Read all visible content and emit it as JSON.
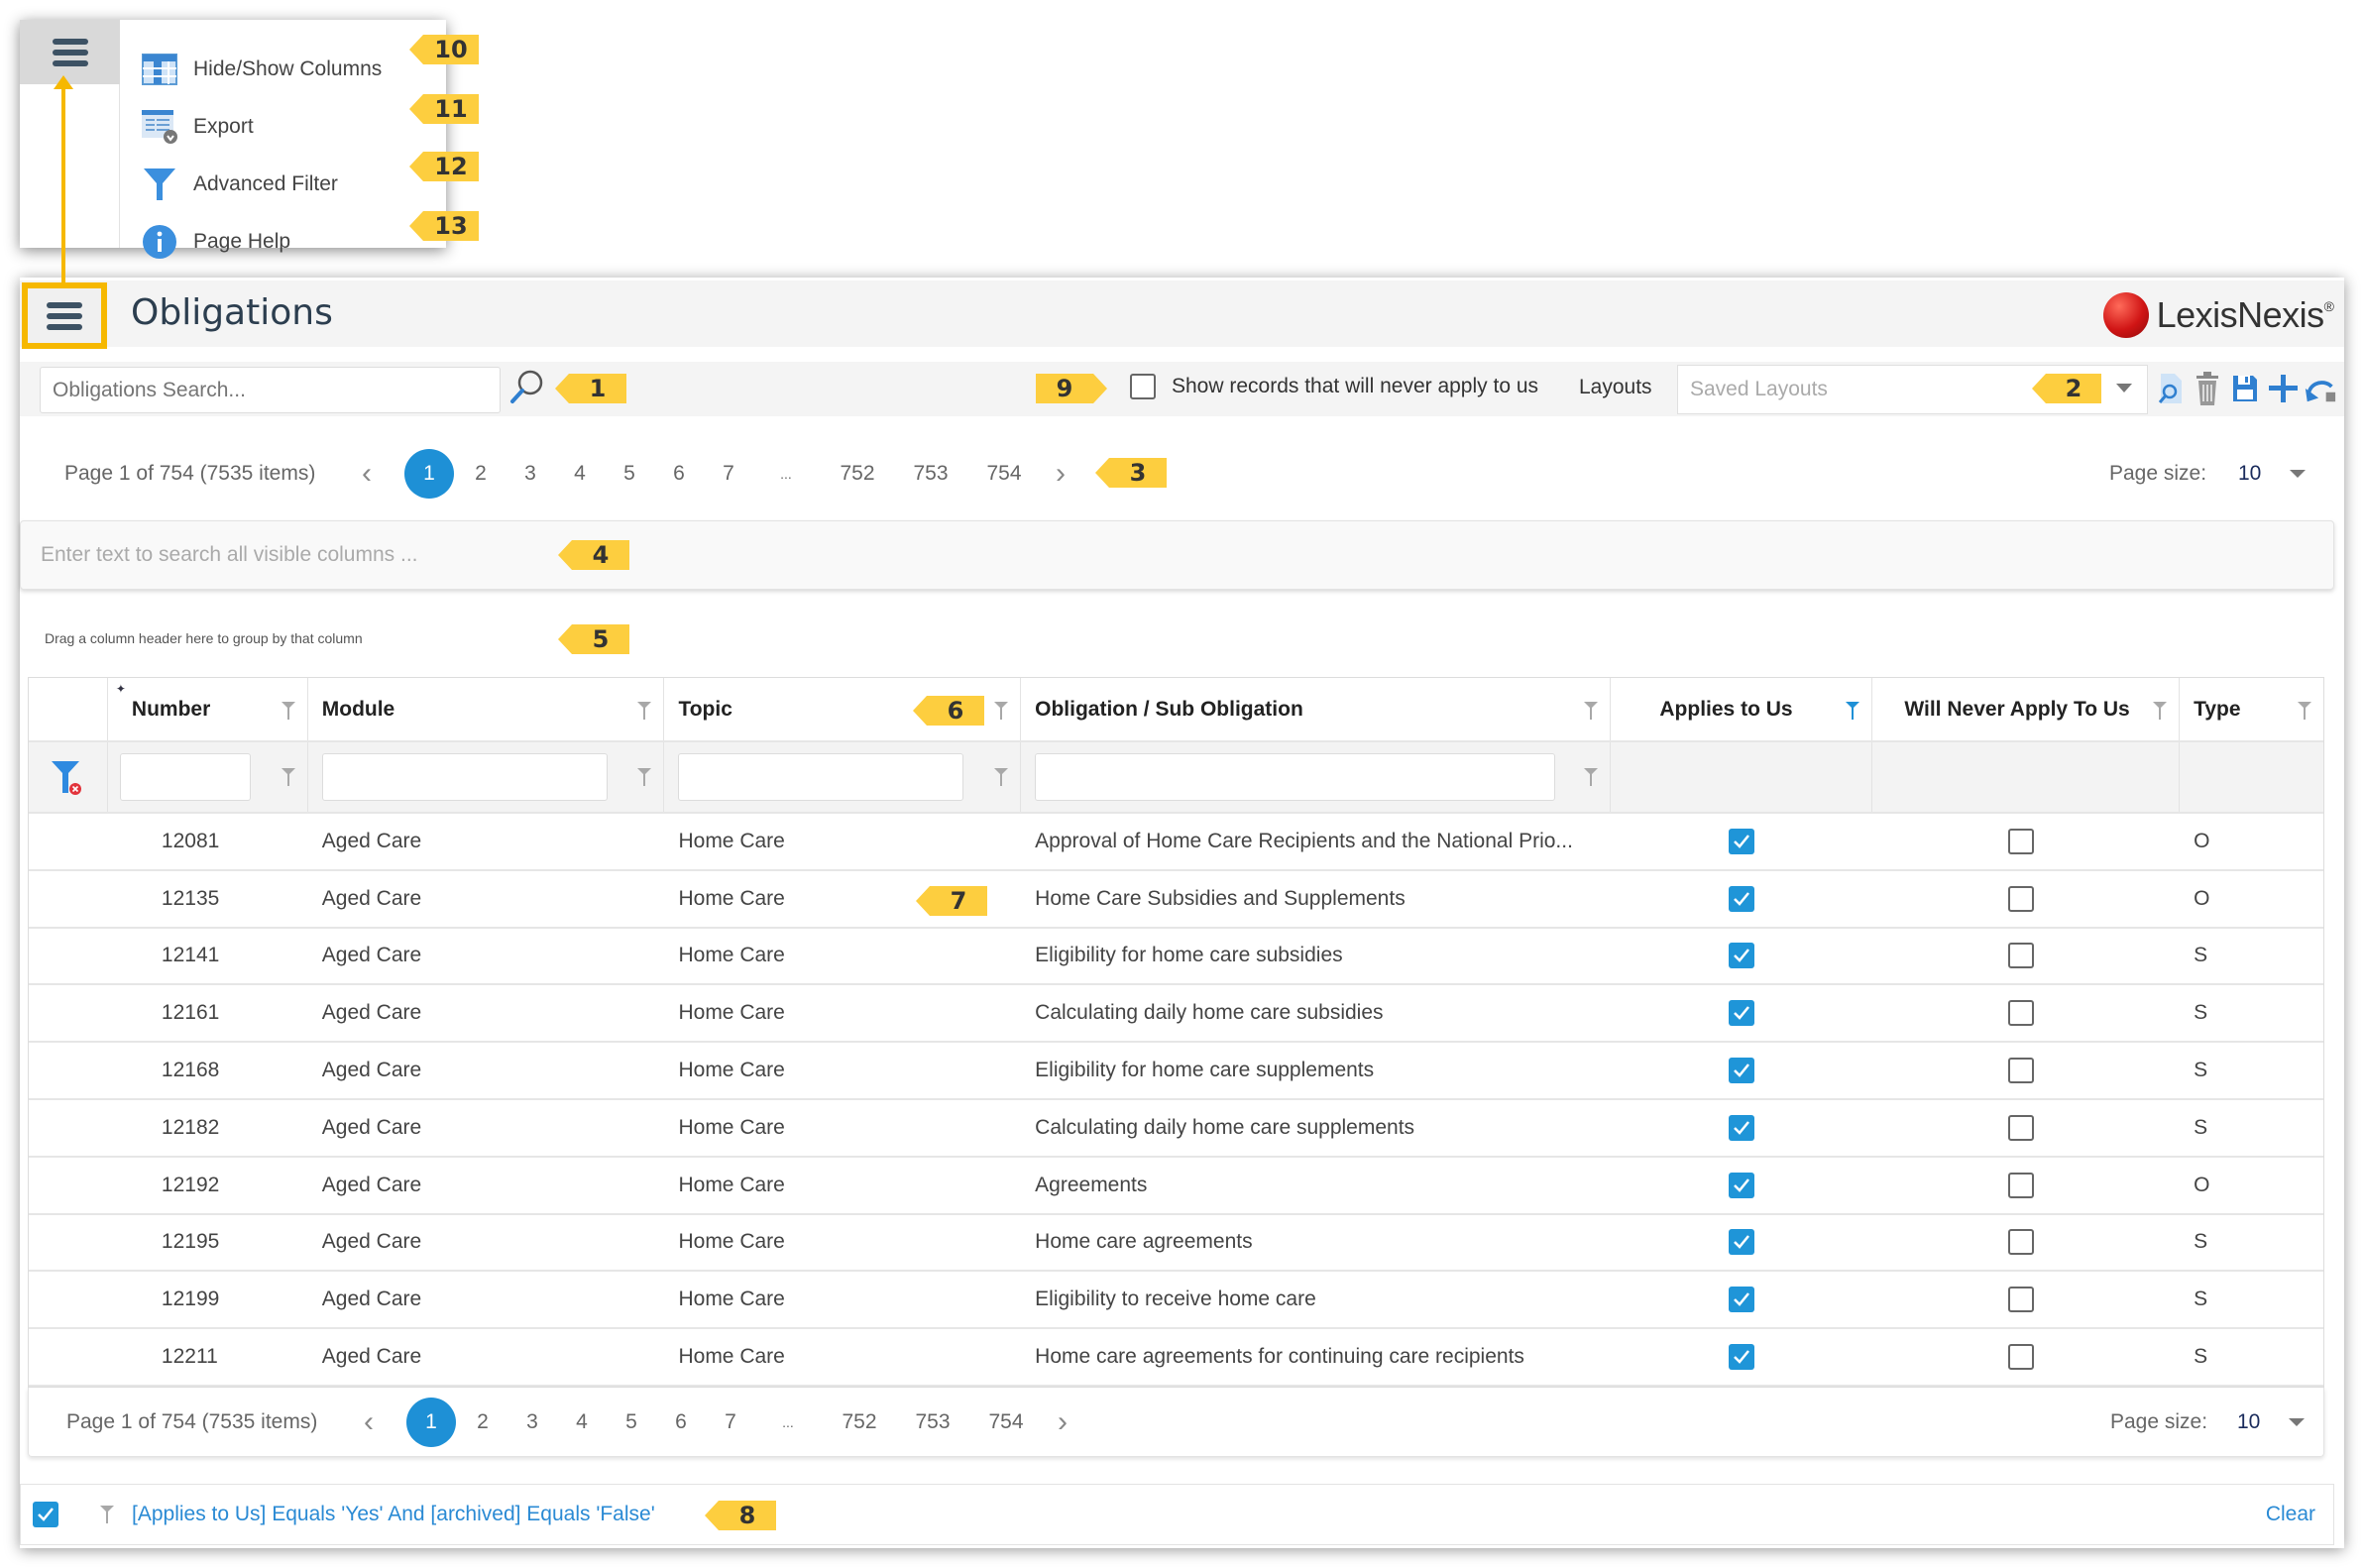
{
  "menu": {
    "items": [
      {
        "label": "Hide/Show Columns",
        "icon": "columns-icon",
        "callout": "10"
      },
      {
        "label": "Export",
        "icon": "export-icon",
        "callout": "11"
      },
      {
        "label": "Advanced Filter",
        "icon": "filter-icon",
        "callout": "12"
      },
      {
        "label": "Page Help",
        "icon": "info-icon",
        "callout": "13"
      }
    ]
  },
  "header": {
    "title": "Obligations",
    "logo_text": "LexisNexis",
    "logo_mark": "®"
  },
  "toolbar": {
    "search_placeholder": "Obligations Search...",
    "search_callout": "1",
    "never_apply_label": "Show records that will never apply to us",
    "never_apply_checked": false,
    "never_apply_callout": "9",
    "layouts_label": "Layouts",
    "layouts_placeholder": "Saved Layouts",
    "layouts_callout": "2",
    "tool_icons": [
      "preview-layout-icon",
      "delete-layout-icon",
      "save-layout-icon",
      "add-layout-icon",
      "reset-layout-icon"
    ]
  },
  "pager": {
    "info": "Page 1 of 754 (7535 items)",
    "pages": [
      "1",
      "2",
      "3",
      "4",
      "5",
      "6",
      "7",
      "...",
      "752",
      "753",
      "754"
    ],
    "current_page": "1",
    "page_size_label": "Page size:",
    "page_size": "10",
    "callout": "3"
  },
  "search_all": {
    "placeholder": "Enter text to search all visible columns ...",
    "callout": "4"
  },
  "group_hint": {
    "text": "Drag a column header here to group by that column",
    "callout": "5"
  },
  "grid": {
    "columns": [
      "Number",
      "Module",
      "Topic",
      "Obligation / Sub Obligation",
      "Applies to Us",
      "Will Never Apply To Us",
      "Type"
    ],
    "header_callout": "6",
    "row_callout": "7",
    "active_filter_column": "Applies to Us",
    "rows": [
      {
        "number": "12081",
        "module": "Aged Care",
        "topic": "Home Care",
        "obligation": "Approval of Home Care Recipients and the National Prio...",
        "applies": true,
        "never": false,
        "type": "O"
      },
      {
        "number": "12135",
        "module": "Aged Care",
        "topic": "Home Care",
        "obligation": "Home Care Subsidies and Supplements",
        "applies": true,
        "never": false,
        "type": "O"
      },
      {
        "number": "12141",
        "module": "Aged Care",
        "topic": "Home Care",
        "obligation": "Eligibility for home care subsidies",
        "applies": true,
        "never": false,
        "type": "S"
      },
      {
        "number": "12161",
        "module": "Aged Care",
        "topic": "Home Care",
        "obligation": "Calculating daily home care subsidies",
        "applies": true,
        "never": false,
        "type": "S"
      },
      {
        "number": "12168",
        "module": "Aged Care",
        "topic": "Home Care",
        "obligation": "Eligibility for home care supplements",
        "applies": true,
        "never": false,
        "type": "S"
      },
      {
        "number": "12182",
        "module": "Aged Care",
        "topic": "Home Care",
        "obligation": "Calculating daily home care supplements",
        "applies": true,
        "never": false,
        "type": "S"
      },
      {
        "number": "12192",
        "module": "Aged Care",
        "topic": "Home Care",
        "obligation": "Agreements",
        "applies": true,
        "never": false,
        "type": "O"
      },
      {
        "number": "12195",
        "module": "Aged Care",
        "topic": "Home Care",
        "obligation": "Home care agreements",
        "applies": true,
        "never": false,
        "type": "S"
      },
      {
        "number": "12199",
        "module": "Aged Care",
        "topic": "Home Care",
        "obligation": "Eligibility to receive home care",
        "applies": true,
        "never": false,
        "type": "S"
      },
      {
        "number": "12211",
        "module": "Aged Care",
        "topic": "Home Care",
        "obligation": "Home care agreements for continuing care recipients",
        "applies": true,
        "never": false,
        "type": "S"
      }
    ]
  },
  "filter_bar": {
    "enabled": true,
    "expression": "[Applies to Us] Equals 'Yes' And [archived] Equals 'False'",
    "clear_label": "Clear",
    "callout": "8"
  },
  "colors": {
    "accent": "#1e90d6",
    "callout": "#fdce3f",
    "highlight_border": "#f6b800",
    "link": "#2a8ad4"
  }
}
